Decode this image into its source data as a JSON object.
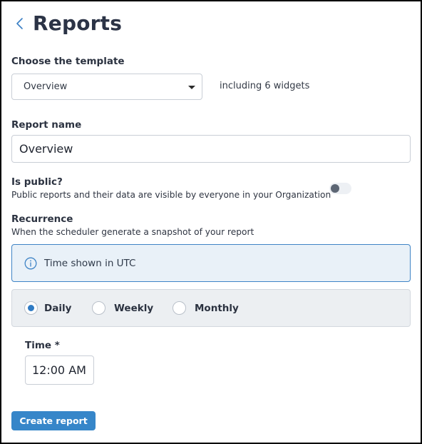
{
  "header": {
    "title": "Reports"
  },
  "template": {
    "label": "Choose the template",
    "selected": "Overview",
    "widgets_text": "including 6 widgets"
  },
  "report_name": {
    "label": "Report name",
    "value": "Overview"
  },
  "is_public": {
    "label": "Is public?",
    "description": "Public reports and their data are visible by everyone in your Organization",
    "enabled": false
  },
  "recurrence": {
    "label": "Recurrence",
    "description": "When the scheduler generate a snapshot of your report",
    "info": "Time shown in UTC",
    "options": [
      "Daily",
      "Weekly",
      "Monthly"
    ],
    "selected": "Daily"
  },
  "time": {
    "label": "Time *",
    "value": "12:00 AM"
  },
  "actions": {
    "create_label": "Create report"
  },
  "colors": {
    "accent": "#3686c9",
    "info_border": "#3f84c6",
    "info_bg": "#e9f1f8"
  },
  "icons": {
    "back": "chevron-left-icon",
    "info": "info-circle-icon",
    "dropdown": "caret-down-icon"
  }
}
